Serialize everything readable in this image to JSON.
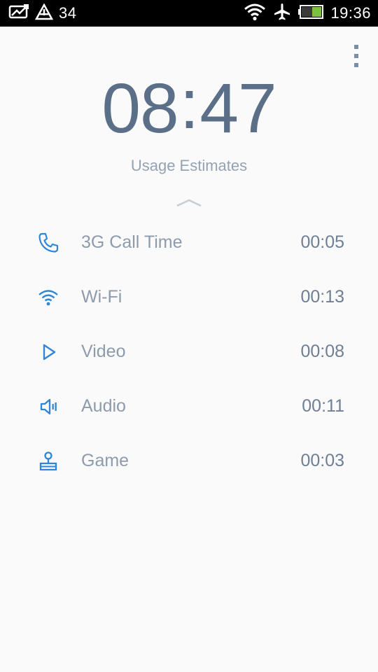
{
  "status_bar": {
    "notification_count": "34",
    "clock": "19:36",
    "icons": [
      "photo-notification-icon",
      "network-alert-icon",
      "wifi-icon",
      "airplane-mode-icon",
      "battery-icon"
    ]
  },
  "header": {
    "hours": "08",
    "separator": ":",
    "minutes": "47",
    "subtitle": "Usage Estimates"
  },
  "menu": {
    "icon": "overflow-menu-icon"
  },
  "colors": {
    "accent": "#2f86d6",
    "big_time": "#5b6f88",
    "label": "#8e9bac",
    "background": "#fafafa"
  },
  "usage_items": [
    {
      "icon": "phone-icon",
      "label": "3G Call Time",
      "value": "00:05"
    },
    {
      "icon": "wifi-icon",
      "label": "Wi-Fi",
      "value": "00:13"
    },
    {
      "icon": "play-icon",
      "label": "Video",
      "value": "00:08"
    },
    {
      "icon": "speaker-icon",
      "label": "Audio",
      "value": "00:11"
    },
    {
      "icon": "joystick-icon",
      "label": "Game",
      "value": "00:03"
    }
  ]
}
